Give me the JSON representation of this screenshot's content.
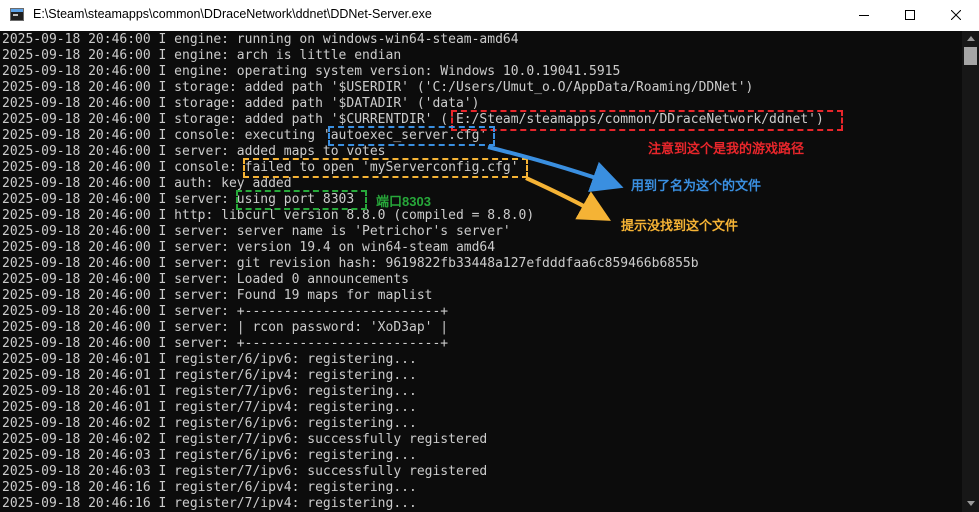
{
  "window": {
    "title": "E:\\Steam\\steamapps\\common\\DDraceNetwork\\ddnet\\DDNet-Server.exe"
  },
  "log_lines": [
    "2025-09-18 20:46:00 I engine: running on windows-win64-steam-amd64",
    "2025-09-18 20:46:00 I engine: arch is little endian",
    "2025-09-18 20:46:00 I engine: operating system version: Windows 10.0.19041.5915",
    "2025-09-18 20:46:00 I storage: added path '$USERDIR' ('C:/Users/Umut_o.O/AppData/Roaming/DDNet')",
    "2025-09-18 20:46:00 I storage: added path '$DATADIR' ('data')",
    "2025-09-18 20:46:00 I storage: added path '$CURRENTDIR' ('E:/Steam/steamapps/common/DDraceNetwork/ddnet')",
    "2025-09-18 20:46:00 I console: executing 'autoexec_server.cfg'",
    "2025-09-18 20:46:00 I server: added maps to votes",
    "2025-09-18 20:46:00 I console: failed to open 'myServerconfig.cfg'",
    "2025-09-18 20:46:00 I auth: key added",
    "2025-09-18 20:46:00 I server: using port 8303",
    "2025-09-18 20:46:00 I http: libcurl version 8.8.0 (compiled = 8.8.0)",
    "2025-09-18 20:46:00 I server: server name is 'Petrichor's server'",
    "2025-09-18 20:46:00 I server: version 19.4 on win64-steam amd64",
    "2025-09-18 20:46:00 I server: git revision hash: 9619822fb33448a127efdddfaa6c859466b6855b",
    "2025-09-18 20:46:00 I server: Loaded 0 announcements",
    "2025-09-18 20:46:00 I server: Found 19 maps for maplist",
    "2025-09-18 20:46:00 I server: +-------------------------+",
    "2025-09-18 20:46:00 I server: | rcon password: 'XoD3ap' |",
    "2025-09-18 20:46:00 I server: +-------------------------+",
    "2025-09-18 20:46:01 I register/6/ipv6: registering...",
    "2025-09-18 20:46:01 I register/6/ipv4: registering...",
    "2025-09-18 20:46:01 I register/7/ipv6: registering...",
    "2025-09-18 20:46:01 I register/7/ipv4: registering...",
    "2025-09-18 20:46:02 I register/6/ipv6: registering...",
    "2025-09-18 20:46:02 I register/7/ipv6: successfully registered",
    "2025-09-18 20:46:03 I register/6/ipv6: registering...",
    "2025-09-18 20:46:03 I register/7/ipv6: successfully registered",
    "2025-09-18 20:46:16 I register/6/ipv4: registering...",
    "2025-09-18 20:46:16 I register/7/ipv4: registering..."
  ],
  "annotations": {
    "game_path_note": "注意到这个是我的游戏路径",
    "file_used_note": "用到了名为这个的文件",
    "file_missing_note": "提示没找到这个文件",
    "port_note": "端口8303"
  },
  "colors": {
    "console_bg": "#0c0c0c",
    "console_text": "#cccccc",
    "red_annotation": "#e8262b",
    "blue_annotation": "#3a8fe0",
    "orange_annotation": "#f5b335",
    "green_annotation": "#27a83a"
  },
  "icons": [
    "console-app-icon",
    "minimize-icon",
    "maximize-icon",
    "close-icon",
    "scroll-up-arrow-icon",
    "scroll-down-arrow-icon"
  ]
}
